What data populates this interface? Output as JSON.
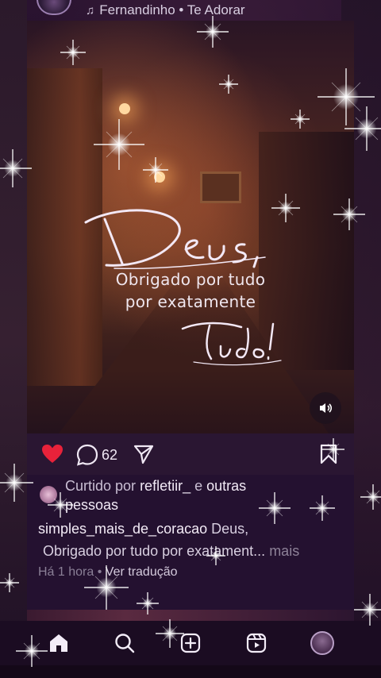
{
  "top_audio": {
    "icon": "music-note-icon",
    "text": "Fernandinho • Te Adorar"
  },
  "media": {
    "overlay_caption_line1": "Obrigado por tudo",
    "overlay_caption_line2": "por exatamente"
  },
  "actions": {
    "comment_count": "62",
    "like_color": "#e8223a"
  },
  "liked_by": {
    "prefix": "Curtido por",
    "user": "refletiir_",
    "connector": "e",
    "others": "outras",
    "others_line2": "pessoas"
  },
  "caption": {
    "username": "simples_mais_de_coracao",
    "text_line1": "Deus,",
    "text_line2": "Obrigado por tudo por exatament...",
    "more": "mais"
  },
  "meta": {
    "time": "Há 1 hora",
    "separator": "•",
    "translate": "Ver tradução"
  },
  "bottom_nav": {
    "items": [
      "home-icon",
      "search-icon",
      "create-icon",
      "reels-icon",
      "profile-avatar"
    ]
  }
}
